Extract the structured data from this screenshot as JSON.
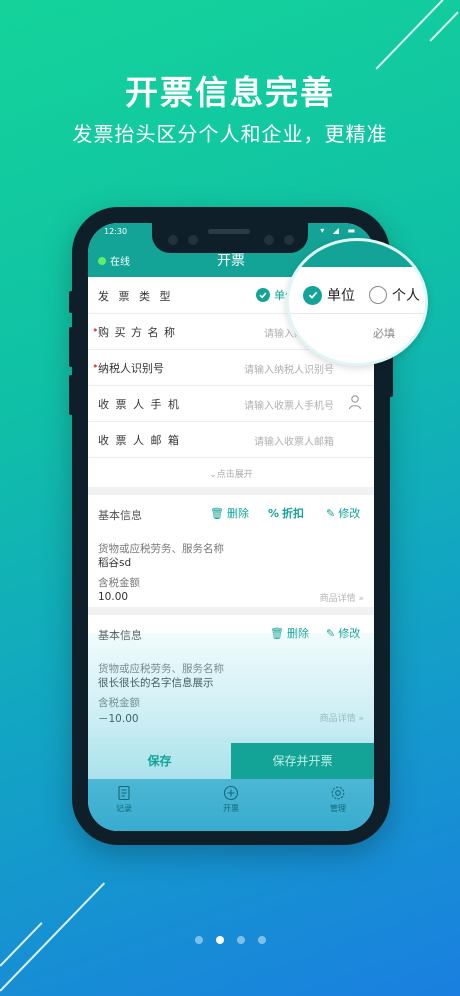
{
  "hero": {
    "title": "开票信息完善",
    "subtitle": "发票抬头区分个人和企业，更精准"
  },
  "status_bar": {
    "time": "12:30",
    "icons": "▾ ◢ ▬"
  },
  "header": {
    "online_label": "在线",
    "title": "开票"
  },
  "form": {
    "type_label": "发 票 类 型",
    "type_selected": "单位",
    "buyer_name_label": "购 买 方 名 称",
    "buyer_name_placeholder": "请输入购买",
    "tax_id_label": "纳税人识别号",
    "tax_id_placeholder": "请输入纳税人识别号",
    "phone_label": "收 票 人 手 机",
    "phone_placeholder": "请输入收票人手机号",
    "email_label": "收 票 人 邮 箱",
    "email_placeholder": "请输入收票人邮箱",
    "expand_label": "点击展开",
    "required_mark": "•"
  },
  "items": [
    {
      "section_label": "基本信息",
      "delete_label": "删除",
      "discount_label": "折扣",
      "edit_label": "修改",
      "name_label": "货物或应税劳务、服务名称",
      "name_value": "稻谷sd",
      "amount_label": "含税金额",
      "amount_value": "10.00",
      "detail_label": "商品详情"
    },
    {
      "section_label": "基本信息",
      "delete_label": "删除",
      "edit_label": "修改",
      "name_label": "货物或应税劳务、服务名称",
      "name_value": "很长很长的名字信息展示",
      "amount_label": "含税金额",
      "amount_value": "－10.00",
      "detail_label": "商品详情"
    }
  ],
  "actions": {
    "save": "保存",
    "save_and_issue": "保存并开票"
  },
  "tabs": [
    {
      "label": "记录",
      "icon": "document-icon"
    },
    {
      "label": "开票",
      "icon": "plus-circle-icon"
    },
    {
      "label": "管理",
      "icon": "gear-icon"
    }
  ],
  "magnifier": {
    "option_company": "单位",
    "option_personal": "个人",
    "required_hint": "必填"
  },
  "pager": {
    "count": 4,
    "active_index": 1
  },
  "colors": {
    "accent": "#13a497",
    "required": "#e04a4a",
    "online": "#5ff06a"
  }
}
